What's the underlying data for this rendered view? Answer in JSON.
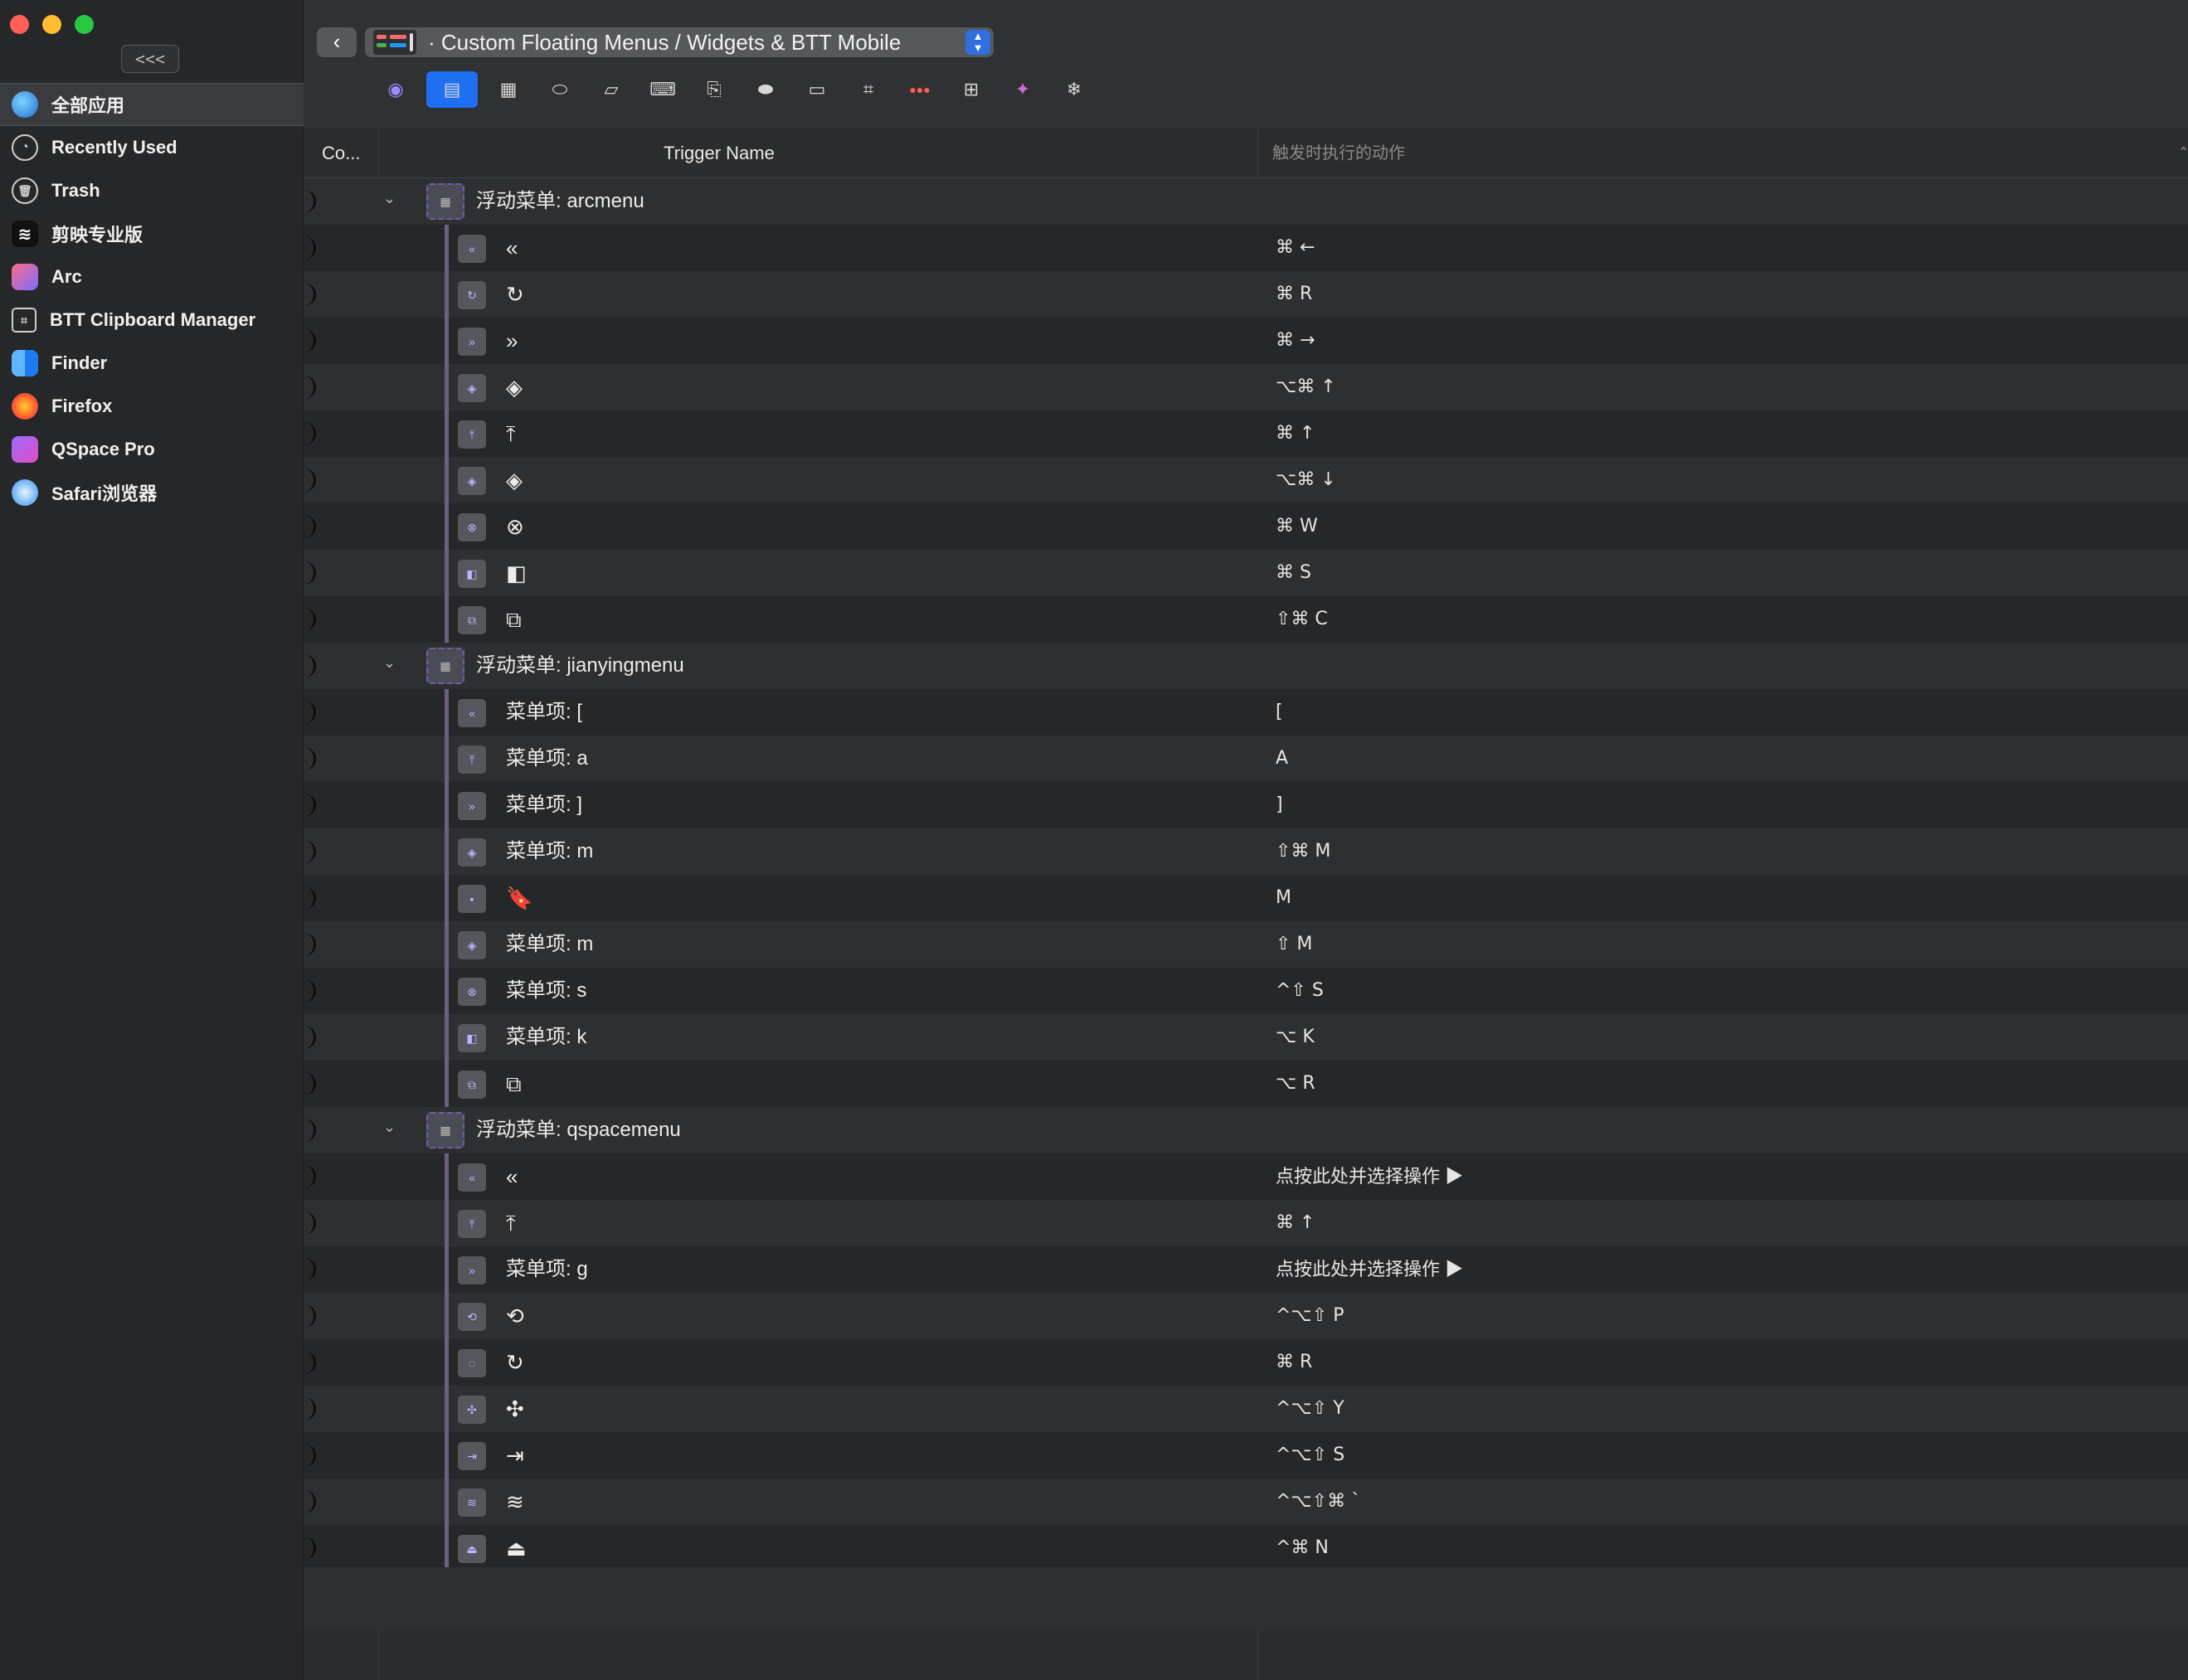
{
  "window": {
    "collapse_label": "<<<"
  },
  "sidebar": {
    "apps": [
      {
        "label": "全部应用",
        "icon": "globe-icon",
        "cls": "ic-all",
        "glyph": "",
        "selected": true
      },
      {
        "label": "Recently Used",
        "icon": "clock-icon",
        "cls": "ic-recent",
        "glyph": "◔"
      },
      {
        "label": "Trash",
        "icon": "trash-icon",
        "cls": "ic-trash",
        "glyph": "🗑"
      },
      {
        "label": "剪映专业版",
        "icon": "capcut-icon",
        "cls": "ic-jy",
        "glyph": "≋"
      },
      {
        "label": "Arc",
        "icon": "arc-icon",
        "cls": "ic-arc",
        "glyph": ""
      },
      {
        "label": "BTT Clipboard Manager",
        "icon": "clipboard-icon",
        "cls": "ic-btt",
        "glyph": "⌗"
      },
      {
        "label": "Finder",
        "icon": "finder-icon",
        "cls": "ic-finder",
        "glyph": ""
      },
      {
        "label": "Firefox",
        "icon": "firefox-icon",
        "cls": "ic-firefox",
        "glyph": ""
      },
      {
        "label": "QSpace Pro",
        "icon": "qspace-icon",
        "cls": "ic-qspace",
        "glyph": ""
      },
      {
        "label": "Safari浏览器",
        "icon": "safari-icon",
        "cls": "ic-safari",
        "glyph": ""
      }
    ]
  },
  "toolbar": {
    "path_label": "· Custom Floating Menus / Widgets & BTT Mobile",
    "icons": [
      {
        "name": "trackpad-circle-icon",
        "glyph": "◉"
      },
      {
        "name": "floating-menu-icon",
        "glyph": "▤",
        "selected": true
      },
      {
        "name": "touch-bar-grid-icon",
        "glyph": "▦"
      },
      {
        "name": "magic-mouse-icon",
        "glyph": "⬭"
      },
      {
        "name": "trackpad-icon",
        "glyph": "▱"
      },
      {
        "name": "keyboard-icon",
        "glyph": "⌨"
      },
      {
        "name": "key-sequence-icon",
        "glyph": "⎘"
      },
      {
        "name": "normal-mouse-icon",
        "glyph": "⬬"
      },
      {
        "name": "siri-remote-icon",
        "glyph": "▭"
      },
      {
        "name": "drawing-icon",
        "glyph": "⌗"
      },
      {
        "name": "window-snap-icon",
        "glyph": "●●●"
      },
      {
        "name": "controller-icon",
        "glyph": "⊞"
      },
      {
        "name": "gesture-icon",
        "glyph": "✦"
      },
      {
        "name": "automation-icon",
        "glyph": "❄"
      }
    ]
  },
  "table": {
    "col_co": "Co...",
    "col_trigger": "Trigger Name",
    "col_action": "触发时执行的动作",
    "rows": [
      {
        "type": "menu",
        "name": "浮动菜单: arcmenu",
        "action": ""
      },
      {
        "type": "item",
        "icon": "«",
        "name": "«",
        "glyph": true,
        "action": "⌘ ←"
      },
      {
        "type": "item",
        "icon": "↻",
        "name": "↻",
        "glyph": true,
        "action": "⌘ R"
      },
      {
        "type": "item",
        "icon": "»",
        "name": "»",
        "glyph": true,
        "action": "⌘ →"
      },
      {
        "type": "item",
        "icon": "◈",
        "name": "◈",
        "glyph": true,
        "action": "⌥⌘ ↑"
      },
      {
        "type": "item",
        "icon": "⤒",
        "name": "⤒",
        "glyph": true,
        "action": "⌘ ↑"
      },
      {
        "type": "item",
        "icon": "◈",
        "name": "◈",
        "glyph": true,
        "action": "⌥⌘ ↓"
      },
      {
        "type": "item",
        "icon": "⊗",
        "name": "⊗",
        "glyph": true,
        "action": "⌘ W"
      },
      {
        "type": "item",
        "icon": "◧",
        "name": "◧",
        "glyph": true,
        "action": "⌘ S"
      },
      {
        "type": "item",
        "icon": "⧉",
        "name": "⧉",
        "glyph": true,
        "action": "⇧⌘ C"
      },
      {
        "type": "menu",
        "name": "浮动菜单: jianyingmenu",
        "action": ""
      },
      {
        "type": "item",
        "icon": "«",
        "name": "菜单项: [",
        "action": "["
      },
      {
        "type": "item",
        "icon": "⤒",
        "name": "菜单项: a",
        "action": "A"
      },
      {
        "type": "item",
        "icon": "»",
        "name": "菜单项: ]",
        "action": "]"
      },
      {
        "type": "item",
        "icon": "◈",
        "name": "菜单项: m",
        "action": "⇧⌘ M"
      },
      {
        "type": "item",
        "icon": "▪",
        "name": "🔖",
        "glyph": true,
        "action": "M"
      },
      {
        "type": "item",
        "icon": "◈",
        "name": "菜单项: m",
        "action": "⇧ M"
      },
      {
        "type": "item",
        "icon": "⊗",
        "name": "菜单项: s",
        "action": "^⇧ S"
      },
      {
        "type": "item",
        "icon": "◧",
        "name": "菜单项: k",
        "action": "⌥ K"
      },
      {
        "type": "item",
        "icon": "⧉",
        "name": "⧉",
        "glyph": true,
        "action": "⌥ R"
      },
      {
        "type": "menu",
        "name": "浮动菜单: qspacemenu",
        "action": ""
      },
      {
        "type": "item",
        "icon": "«",
        "name": "«",
        "glyph": true,
        "action": "点按此处并选择操作 ▶",
        "hint": true
      },
      {
        "type": "item",
        "icon": "⤒",
        "name": "⤒",
        "glyph": true,
        "action": "⌘ ↑"
      },
      {
        "type": "item",
        "icon": "»",
        "name": "菜单项: g",
        "action": "点按此处并选择操作 ▶",
        "hint": true
      },
      {
        "type": "item",
        "icon": "⟲",
        "name": "⟲",
        "glyph": true,
        "action": "^⌥⇧ P"
      },
      {
        "type": "item",
        "icon": "◌",
        "name": "↻",
        "glyph": true,
        "action": "⌘ R"
      },
      {
        "type": "item",
        "icon": "✣",
        "name": "✣",
        "glyph": true,
        "action": "^⌥⇧ Y"
      },
      {
        "type": "item",
        "icon": "⇥",
        "name": "⇥",
        "glyph": true,
        "action": "^⌥⇧ S"
      },
      {
        "type": "item",
        "icon": "≋",
        "name": "≋",
        "glyph": true,
        "action": "^⌥⇧⌘ `"
      },
      {
        "type": "item",
        "icon": "⏏",
        "name": "⏏",
        "glyph": true,
        "action": "^⌘ N"
      }
    ]
  }
}
